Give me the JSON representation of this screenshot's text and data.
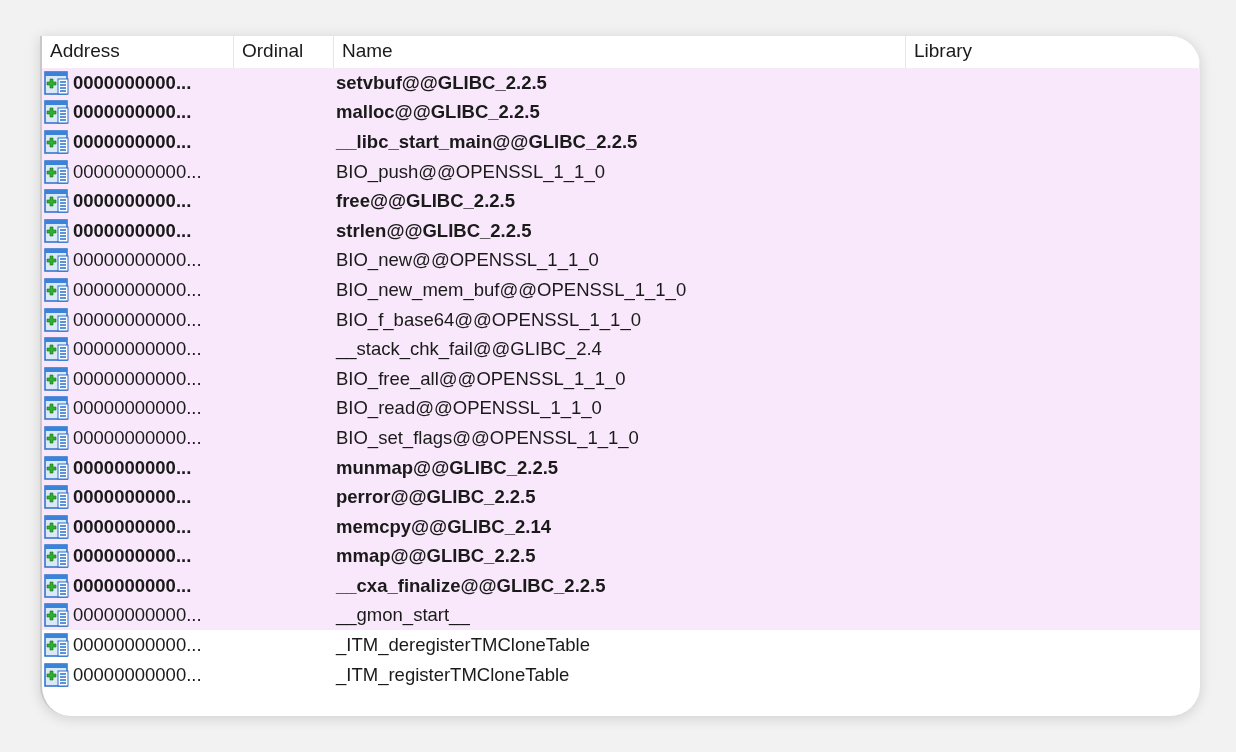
{
  "table": {
    "columns": [
      "Address",
      "Ordinal",
      "Name",
      "Library"
    ],
    "rows": [
      {
        "address": "0000000000...",
        "name": "setvbuf@@GLIBC_2.2.5",
        "bold": true,
        "highlighted": true
      },
      {
        "address": "0000000000...",
        "name": "malloc@@GLIBC_2.2.5",
        "bold": true,
        "highlighted": true
      },
      {
        "address": "0000000000...",
        "name": "__libc_start_main@@GLIBC_2.2.5",
        "bold": true,
        "highlighted": true
      },
      {
        "address": "00000000000...",
        "name": "BIO_push@@OPENSSL_1_1_0",
        "bold": false,
        "highlighted": true
      },
      {
        "address": "0000000000...",
        "name": "free@@GLIBC_2.2.5",
        "bold": true,
        "highlighted": true
      },
      {
        "address": "0000000000...",
        "name": "strlen@@GLIBC_2.2.5",
        "bold": true,
        "highlighted": true
      },
      {
        "address": "00000000000...",
        "name": "BIO_new@@OPENSSL_1_1_0",
        "bold": false,
        "highlighted": true
      },
      {
        "address": "00000000000...",
        "name": "BIO_new_mem_buf@@OPENSSL_1_1_0",
        "bold": false,
        "highlighted": true
      },
      {
        "address": "00000000000...",
        "name": "BIO_f_base64@@OPENSSL_1_1_0",
        "bold": false,
        "highlighted": true
      },
      {
        "address": "00000000000...",
        "name": "__stack_chk_fail@@GLIBC_2.4",
        "bold": false,
        "highlighted": true
      },
      {
        "address": "00000000000...",
        "name": "BIO_free_all@@OPENSSL_1_1_0",
        "bold": false,
        "highlighted": true
      },
      {
        "address": "00000000000...",
        "name": "BIO_read@@OPENSSL_1_1_0",
        "bold": false,
        "highlighted": true
      },
      {
        "address": "00000000000...",
        "name": "BIO_set_flags@@OPENSSL_1_1_0",
        "bold": false,
        "highlighted": true
      },
      {
        "address": "0000000000...",
        "name": "munmap@@GLIBC_2.2.5",
        "bold": true,
        "highlighted": true
      },
      {
        "address": "0000000000...",
        "name": "perror@@GLIBC_2.2.5",
        "bold": true,
        "highlighted": true
      },
      {
        "address": "0000000000...",
        "name": "memcpy@@GLIBC_2.14",
        "bold": true,
        "highlighted": true
      },
      {
        "address": "0000000000...",
        "name": "mmap@@GLIBC_2.2.5",
        "bold": true,
        "highlighted": true
      },
      {
        "address": "0000000000...",
        "name": "__cxa_finalize@@GLIBC_2.2.5",
        "bold": true,
        "highlighted": true
      },
      {
        "address": "00000000000...",
        "name": "__gmon_start__",
        "bold": false,
        "highlighted": true
      },
      {
        "address": "00000000000...",
        "name": "_ITM_deregisterTMCloneTable",
        "bold": false,
        "highlighted": false
      },
      {
        "address": "00000000000...",
        "name": "_ITM_registerTMCloneTable",
        "bold": false,
        "highlighted": false
      }
    ]
  }
}
